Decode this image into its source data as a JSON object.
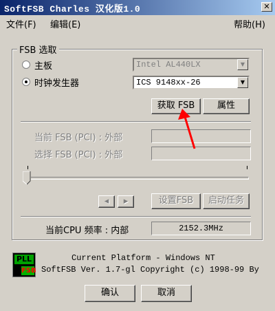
{
  "window": {
    "title": "SoftFSB Charles 汉化版1.0",
    "close": "✕"
  },
  "menu": {
    "file": "文件(F)",
    "edit": "编辑(E)",
    "help": "帮助(H)"
  },
  "fsb_group": {
    "title": "FSB 选取",
    "mainboard_label": "主板",
    "mainboard_value": "Intel AL440LX",
    "clockgen_label": "时钟发生器",
    "clockgen_value": "ICS 9148xx-26",
    "selected": "clockgen"
  },
  "buttons": {
    "get_fsb": "获取 FSB",
    "properties": "属性",
    "left": "◂",
    "right": "▸",
    "set_fsb": "设置FSB",
    "start_task": "启动任务",
    "ok": "确认",
    "cancel": "取消"
  },
  "fsb_info": {
    "current_label": "当前 FSB (PCI) : 外部",
    "select_label": "选择 FSB (PCI) : 外部"
  },
  "cpu": {
    "label": "当前CPU 频率 : 内部",
    "value": "2152.3MHz"
  },
  "logo": {
    "top": "PLL",
    "bottom": "FSB"
  },
  "about": {
    "line1": "Current Platform - Windows NT",
    "line2": "SoftFSB Ver. 1.7-gl  Copyright (c) 1998-99 By"
  },
  "colors": {
    "titlebar_start": "#0a246a",
    "titlebar_end": "#a6caf0",
    "face": "#d4d0c8",
    "annotation": "#ff0000"
  }
}
